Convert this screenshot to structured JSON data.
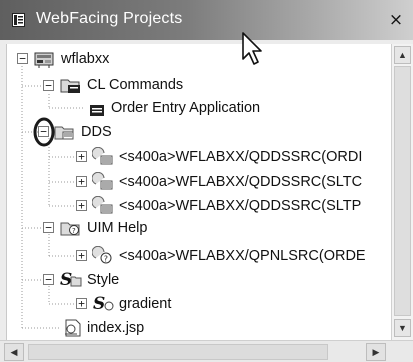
{
  "window": {
    "title": "WebFacing Projects",
    "close_glyph": "×"
  },
  "tree": {
    "items": [
      {
        "label": "wflabxx",
        "icon": "project-icon",
        "state": "expanded"
      },
      {
        "label": "CL Commands",
        "icon": "cl-folder-icon",
        "state": "expanded"
      },
      {
        "label": "Order Entry Application",
        "icon": "cl-command-icon",
        "state": "leaf"
      },
      {
        "label": "DDS",
        "icon": "dds-folder-icon",
        "state": "expanded"
      },
      {
        "label": "<s400a>WFLABXX/QDDSSRC(ORDI",
        "icon": "dds-member-icon",
        "state": "collapsed"
      },
      {
        "label": "<s400a>WFLABXX/QDDSSRC(SLTC",
        "icon": "dds-member-icon",
        "state": "collapsed"
      },
      {
        "label": "<s400a>WFLABXX/QDDSSRC(SLTP",
        "icon": "dds-member-icon",
        "state": "collapsed"
      },
      {
        "label": "UIM Help",
        "icon": "uim-folder-icon",
        "state": "expanded"
      },
      {
        "label": "<s400a>WFLABXX/QPNLSRC(ORDE",
        "icon": "uim-member-icon",
        "state": "collapsed"
      },
      {
        "label": "Style",
        "icon": "style-folder-icon",
        "state": "expanded"
      },
      {
        "label": "gradient",
        "icon": "style-item-icon",
        "state": "collapsed"
      },
      {
        "label": "index.jsp",
        "icon": "jsp-file-icon",
        "state": "leaf"
      }
    ]
  },
  "scrollbars": {
    "up_glyph": "▲",
    "down_glyph": "▼",
    "left_glyph": "◀",
    "right_glyph": "▶"
  },
  "colors": {
    "title_gradient_start": "#5f5f5f",
    "title_gradient_end": "#cfcfcf",
    "highlight_circle": "#1a1a1a"
  }
}
